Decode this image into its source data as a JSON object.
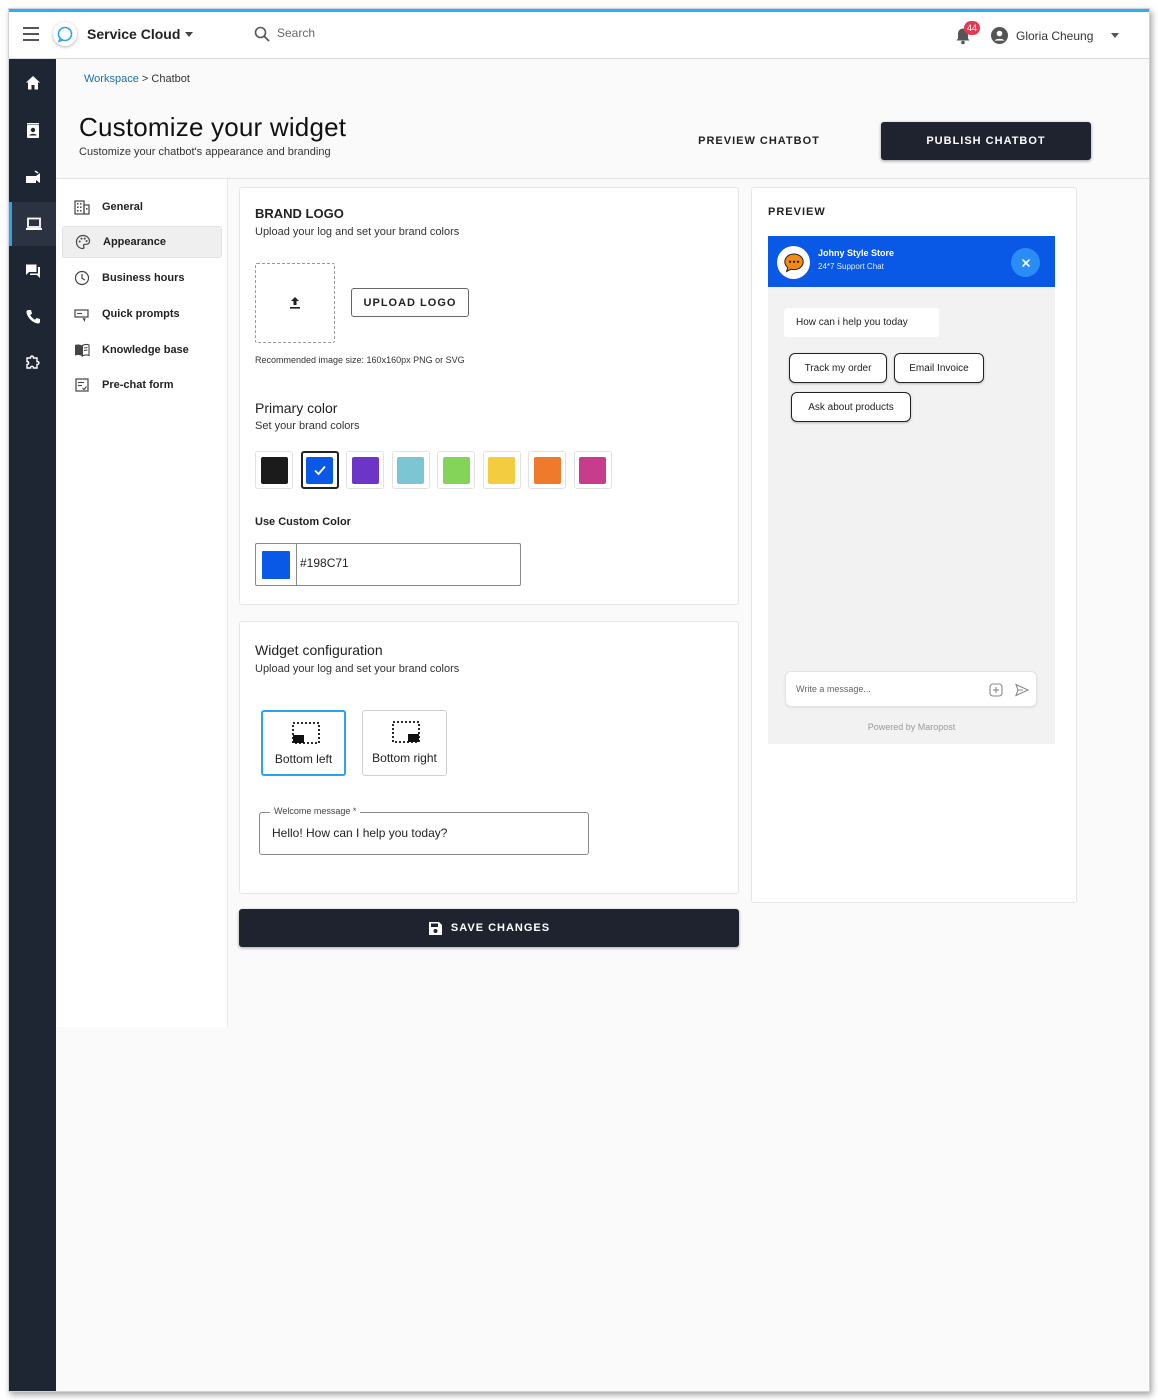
{
  "header": {
    "app_name": "Service Cloud",
    "search_placeholder": "Search",
    "notification_count": "44",
    "user_name": "Gloria Cheung"
  },
  "breadcrumb": {
    "root": "Workspace",
    "separator": ">",
    "current": "Chatbot"
  },
  "page": {
    "title": "Customize your widget",
    "subtitle": "Customize your chatbot's appearance and branding",
    "preview_button": "PREVIEW CHATBOT",
    "publish_button": "PUBLISH CHATBOT"
  },
  "subnav": {
    "items": [
      {
        "label": "General",
        "icon": "building-icon"
      },
      {
        "label": "Appearance",
        "icon": "palette-icon",
        "active": true
      },
      {
        "label": "Business hours",
        "icon": "clock-icon"
      },
      {
        "label": "Quick prompts",
        "icon": "quick-prompt-icon"
      },
      {
        "label": "Knowledge base",
        "icon": "book-icon"
      },
      {
        "label": "Pre-chat form",
        "icon": "form-icon"
      }
    ]
  },
  "brand": {
    "title": "BRAND LOGO",
    "subtitle": "Upload your log and set your brand colors",
    "upload_button": "UPLOAD LOGO",
    "recommendation": "Recommended image size: 160x160px PNG or SVG"
  },
  "colors": {
    "title": "Primary color",
    "subtitle": "Set your brand colors",
    "swatches": [
      "#1b1b1b",
      "#0a58e6",
      "#6c35c6",
      "#7cc6d4",
      "#84d45a",
      "#f3cc3f",
      "#ef7a2b",
      "#c83c8c"
    ],
    "selected_index": 1,
    "custom_label": "Use Custom Color",
    "custom_value": "#198C71",
    "custom_preview_color": "#0a58e6"
  },
  "widget": {
    "title": "Widget configuration",
    "subtitle": "Upload your log and set your brand colors",
    "positions": [
      "Bottom left",
      "Bottom right"
    ],
    "selected_position": "Bottom left",
    "welcome_label": "Welcome message *",
    "welcome_value": "Hello! How can I help you today?",
    "save_button": "SAVE CHANGES"
  },
  "preview": {
    "label": "PREVIEW",
    "store_name": "Johny Style Store",
    "store_sub": "24*7 Support Chat",
    "bot_message": "How can i help you today",
    "chips": [
      "Track my order",
      "Email Invoice",
      "Ask about products"
    ],
    "message_placeholder": "Write a message...",
    "powered_by": "Powered by Maropost",
    "header_color": "#0a58e6"
  },
  "leftbar": {
    "icons": [
      "home-icon",
      "contacts-icon",
      "campaign-icon",
      "laptop-icon",
      "chat-icon",
      "phone-icon",
      "puzzle-icon"
    ],
    "active": "laptop-icon"
  }
}
